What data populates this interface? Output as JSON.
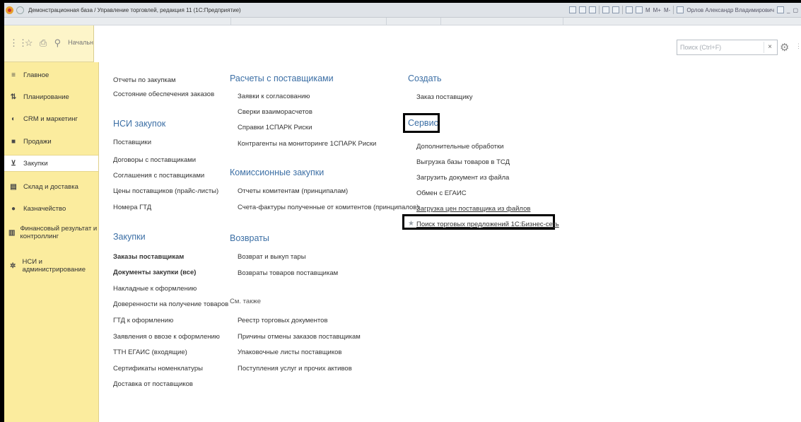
{
  "window": {
    "title": "Демонстрационная база / Управление торговлей, редакция 11 (1С:Предприятие)",
    "user": "Орлов Александр Владимирович",
    "toolbar_labels": [
      "M",
      "M+",
      "M-"
    ]
  },
  "section_header": {
    "start_page_label": "Начальн"
  },
  "search": {
    "placeholder": "Поиск (Ctrl+F)",
    "clear_label": "×"
  },
  "sidebar": {
    "items": [
      {
        "label": "Главное",
        "icon": "menu-icon"
      },
      {
        "label": "Планирование",
        "icon": "planning-icon"
      },
      {
        "label": "CRM и маркетинг",
        "icon": "crm-icon"
      },
      {
        "label": "Продажи",
        "icon": "sales-bag-icon"
      },
      {
        "label": "Закупки",
        "icon": "cart-icon"
      },
      {
        "label": "Склад и доставка",
        "icon": "warehouse-icon"
      },
      {
        "label": "Казначейство",
        "icon": "treasury-icon"
      },
      {
        "label": "Финансовый результат и контроллинг",
        "icon": "chart-icon"
      },
      {
        "label": "НСИ и администрирование",
        "icon": "gear-icon"
      }
    ],
    "active_index": 4
  },
  "content": {
    "col1": {
      "top_links": [
        "Отчеты по закупкам",
        "Состояние обеспечения заказов"
      ],
      "nsi_header": "НСИ закупок",
      "nsi_links": [
        "Поставщики",
        "Договоры с поставщиками",
        "Соглашения с поставщиками",
        "Цены поставщиков (прайс-листы)",
        "Номера ГТД"
      ],
      "purchases_header": "Закупки",
      "purchases_links": [
        "Заказы поставщикам",
        "Документы закупки (все)",
        "Накладные к оформлению",
        "Доверенности на получение товаров",
        "ГТД к оформлению",
        "Заявления о ввозе к оформлению",
        "ТТН ЕГАИС (входящие)",
        "Сертификаты номенклатуры",
        "Доставка от поставщиков"
      ]
    },
    "col2": {
      "settlements_header": "Расчеты с поставщиками",
      "settlements_links": [
        "Заявки к согласованию",
        "Сверки взаиморасчетов",
        "Справки 1СПАРК Риски",
        "Контрагенты на мониторинге 1СПАРК Риски"
      ],
      "commission_header": "Комиссионные закупки",
      "commission_links": [
        "Отчеты комитентам (принципалам)",
        "Счета-фактуры полученные от комитентов (принципалов)"
      ],
      "returns_header": "Возвраты",
      "returns_links": [
        "Возврат и выкуп тары",
        "Возвраты товаров поставщикам"
      ],
      "see_also_label": "См. также",
      "see_also_links": [
        "Реестр торговых документов",
        "Причины отмены заказов поставщикам",
        "Упаковочные листы поставщиков",
        "Поступления услуг и прочих активов"
      ]
    },
    "col3": {
      "create_header": "Создать",
      "create_links": [
        "Заказ поставщику"
      ],
      "service_header": "Сервис",
      "service_links": [
        "Дополнительные обработки",
        "Выгрузка базы товаров в ТСД",
        "Загрузить документ из файла",
        "Обмен с ЕГАИС",
        "Загрузка цен поставщика из файлов",
        "Поиск торговых предложений 1С:Бизнес-сеть"
      ]
    }
  }
}
